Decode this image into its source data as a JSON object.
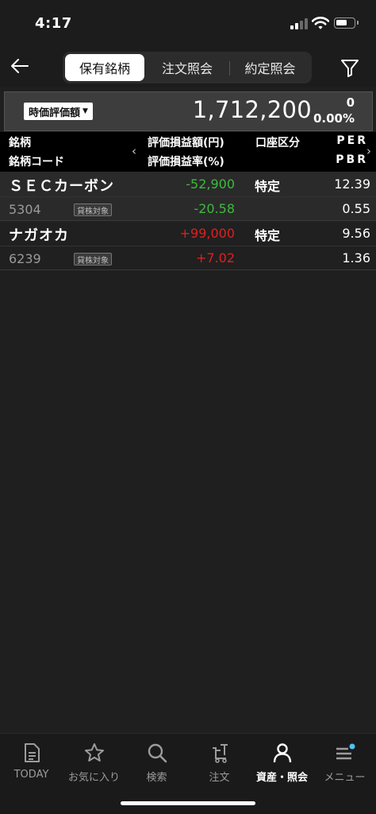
{
  "status_bar": {
    "time": "4:17"
  },
  "header": {
    "tabs": [
      {
        "label": "保有銘柄",
        "active": true
      },
      {
        "label": "注文照会",
        "active": false
      },
      {
        "label": "約定照会",
        "active": false
      }
    ]
  },
  "summary": {
    "selector_label": "時価評価額",
    "total_value": "1,712,200",
    "change": "0",
    "change_pct": "0.00%"
  },
  "table": {
    "headers": {
      "name": "銘柄",
      "code": "銘柄コード",
      "pl_amount": "評価損益額(円)",
      "pl_rate": "評価損益率(%)",
      "account": "口座区分",
      "per": "PER",
      "pbr": "PBR"
    },
    "rows": [
      {
        "name": "ＳＥＣカーボン",
        "code": "5304",
        "badge": "貸株対象",
        "pl_amount": "-52,900",
        "pl_rate": "-20.58",
        "account": "特定",
        "per": "12.39",
        "pbr": "0.55"
      },
      {
        "name": "ナガオカ",
        "code": "6239",
        "badge": "貸株対象",
        "pl_amount": "+99,000",
        "pl_rate": "+7.02",
        "account": "特定",
        "per": "9.56",
        "pbr": "1.36"
      }
    ]
  },
  "tab_bar": {
    "items": [
      {
        "label": "TODAY",
        "icon": "document-icon"
      },
      {
        "label": "お気に入り",
        "icon": "star-icon"
      },
      {
        "label": "検索",
        "icon": "search-icon"
      },
      {
        "label": "注文",
        "icon": "cart-icon"
      },
      {
        "label": "資産・照会",
        "icon": "person-icon",
        "active": true
      },
      {
        "label": "メニュー",
        "icon": "menu-icon"
      }
    ]
  },
  "colors": {
    "negative": "#3cba3c",
    "positive": "#e01f1f",
    "notification_dot": "#4fc3f7"
  }
}
